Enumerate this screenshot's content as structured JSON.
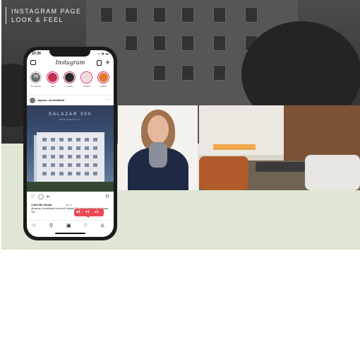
{
  "slide": {
    "title_line1": "INSTAGRAM PAGE",
    "title_line2": "LOOK & FEEL",
    "colors": {
      "green_band": "#dfe6d3",
      "dark_photo": "#474747"
    }
  },
  "phone": {
    "status": {
      "time": "23:39",
      "icons": "▪▪ ◉ ▬"
    },
    "app": {
      "logo": "Instagram",
      "camera_icon": "camera-icon",
      "igtv_icon": "igtv-icon",
      "direct_icon": "direct-message-icon"
    },
    "stories": [
      {
        "name": "Tu historia",
        "color": "#6b6b6b",
        "label_inside": "70"
      },
      {
        "name": "Live",
        "color": "#c0304f",
        "label_inside": ""
      },
      {
        "name": "usuario",
        "color": "#2a2a2a",
        "label_inside": ""
      },
      {
        "name": "usuario",
        "color": "#e8ddd6",
        "label_inside": ""
      },
      {
        "name": "usuario",
        "color": "#e07a2c",
        "label_inside": ""
      }
    ],
    "post": {
      "username": "zapusa_inmobiliaria",
      "more": "···",
      "brand": "SALAZAR 300",
      "brand_sub": "RESIDENCIAL",
      "likes": "1.816 Me Gusta",
      "caption": "@zapusa_inmobiliaria Descubre Salazar 300 un tus espacios de Salazar 300",
      "notifications": {
        "comments": "1",
        "likes": "1",
        "follows": "1"
      }
    },
    "bottom_nav": [
      "home-icon",
      "search-icon",
      "reels-icon",
      "heart-icon",
      "profile-icon"
    ]
  }
}
